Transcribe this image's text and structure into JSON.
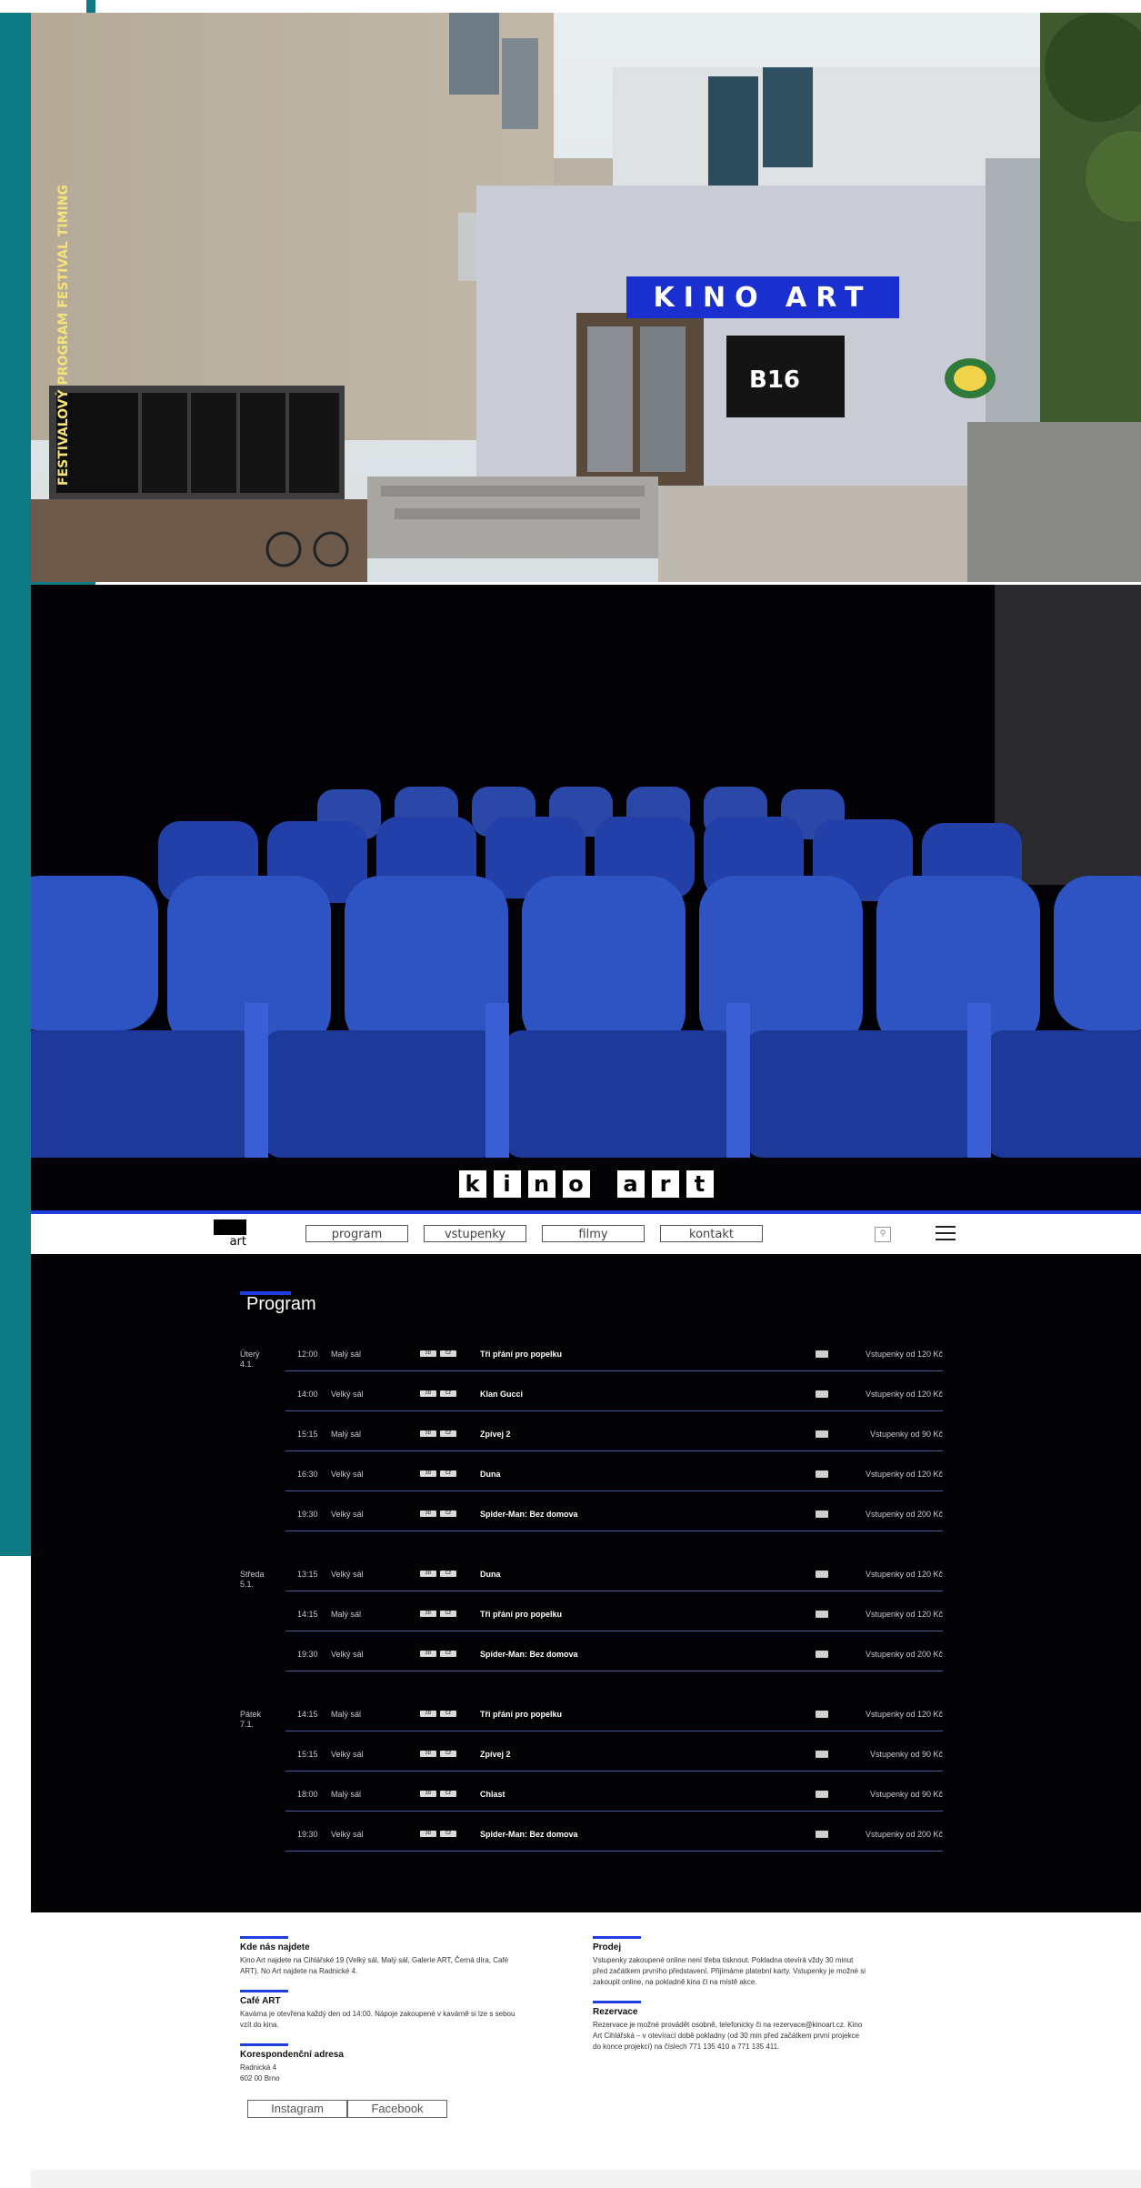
{
  "brand": {
    "logo_letters": [
      "k",
      "i",
      "n",
      "o",
      "a",
      "r",
      "t"
    ],
    "mini_logo": "art",
    "facade_sign": "KINO ART",
    "facade_poster": "B16",
    "facade_vitrine_text": "FESTIVALOVÝ PROGRAM FESTIVAL TIMING"
  },
  "colors": {
    "accent": "#1e3ee0",
    "teal": "#0d7a84",
    "site_bg": "#020204"
  },
  "nav": {
    "items": [
      "program",
      "vstupenky",
      "filmy",
      "kontakt"
    ],
    "search_icon": "search-icon",
    "menu_icon": "hamburger-menu-icon"
  },
  "program": {
    "heading": "Program",
    "rows": [
      {
        "day": "Úterý",
        "date": "4.1.",
        "time": "12:00",
        "hall": "Malý sál",
        "tags": [
          "2D",
          "CZ"
        ],
        "title": "Tři přání pro popelku",
        "price": "Vstupenky od 120 Kč"
      },
      {
        "day": "",
        "date": "",
        "time": "14:00",
        "hall": "Velký sál",
        "tags": [
          "2D",
          "CZ"
        ],
        "title": "Klan Gucci",
        "price": "Vstupenky od 120 Kč"
      },
      {
        "day": "",
        "date": "",
        "time": "15:15",
        "hall": "Malý sál",
        "tags": [
          "2D",
          "CZ"
        ],
        "title": "Zpívej 2",
        "price": "Vstupenky od 90 Kč"
      },
      {
        "day": "",
        "date": "",
        "time": "16:30",
        "hall": "Velký sál",
        "tags": [
          "3D",
          "CZ"
        ],
        "title": "Duna",
        "price": "Vstupenky od 120 Kč"
      },
      {
        "day": "",
        "date": "",
        "time": "19:30",
        "hall": "Velký sál",
        "tags": [
          "3D",
          "CZ"
        ],
        "title": "Spider-Man: Bez domova",
        "price": "Vstupenky od 200 Kč"
      },
      {
        "day": "Středa",
        "date": "5.1.",
        "time": "13:15",
        "hall": "Velký sál",
        "tags": [
          "3D",
          "CZ"
        ],
        "title": "Duna",
        "price": "Vstupenky od 120 Kč"
      },
      {
        "day": "",
        "date": "",
        "time": "14:15",
        "hall": "Malý sál",
        "tags": [
          "2D",
          "CZ"
        ],
        "title": "Tři přání pro popelku",
        "price": "Vstupenky od 120 Kč"
      },
      {
        "day": "",
        "date": "",
        "time": "19:30",
        "hall": "Velký sál",
        "tags": [
          "3D",
          "CZ"
        ],
        "title": "Spider-Man: Bez domova",
        "price": "Vstupenky od 200 Kč"
      },
      {
        "day": "Pátek",
        "date": "7.1.",
        "time": "14:15",
        "hall": "Malý sál",
        "tags": [
          "2D",
          "CZ"
        ],
        "title": "Tři přání pro popelku",
        "price": "Vstupenky od 120 Kč"
      },
      {
        "day": "",
        "date": "",
        "time": "15:15",
        "hall": "Velký sál",
        "tags": [
          "2D",
          "CZ"
        ],
        "title": "Zpívej 2",
        "price": "Vstupenky od 90 Kč"
      },
      {
        "day": "",
        "date": "",
        "time": "18:00",
        "hall": "Malý sál",
        "tags": [
          "3D",
          "CZ"
        ],
        "title": "Chlast",
        "price": "Vstupenky od 90 Kč"
      },
      {
        "day": "",
        "date": "",
        "time": "19:30",
        "hall": "Velký sál",
        "tags": [
          "3D",
          "CZ"
        ],
        "title": "Spider-Man: Bez domova",
        "price": "Vstupenky od 200 Kč"
      }
    ]
  },
  "footer": {
    "find_us": {
      "heading": "Kde nás najdete",
      "text": "Kino Art najdete na Cihlářské 19 (Velký sál, Malý sál, Galerie ART, Černá díra, Café ART). No Art najdete na Radnické 4."
    },
    "cafe": {
      "heading": "Café ART",
      "text": "Kavárna je otevřena každý den od 14:00. Nápoje zakoupené v kavárně si lze s sebou vzít do kina."
    },
    "address": {
      "heading": "Korespondenční adresa",
      "line1": "Radnická 4",
      "line2": "602 00 Brno"
    },
    "sale": {
      "heading": "Prodej",
      "text": "Vstupenky zakoupené online není třeba tisknout. Pokladna otevírá vždy 30 minut před začátkem prvního představení. Přijímáme platební karty. Vstupenky je možné si zakoupit online, na pokladně kina či na místě akce."
    },
    "reservation": {
      "heading": "Rezervace",
      "text": "Rezervace je možné provádět osobně, telefonicky či na rezervace@kinoart.cz. Kino Art Cihlářská – v otevírací době pokladny (od 30 min před začátkem první projekce do konce projekcí) na číslech 771 135 410 a 771 135 411."
    },
    "social": [
      "Instagram",
      "Facebook"
    ]
  }
}
